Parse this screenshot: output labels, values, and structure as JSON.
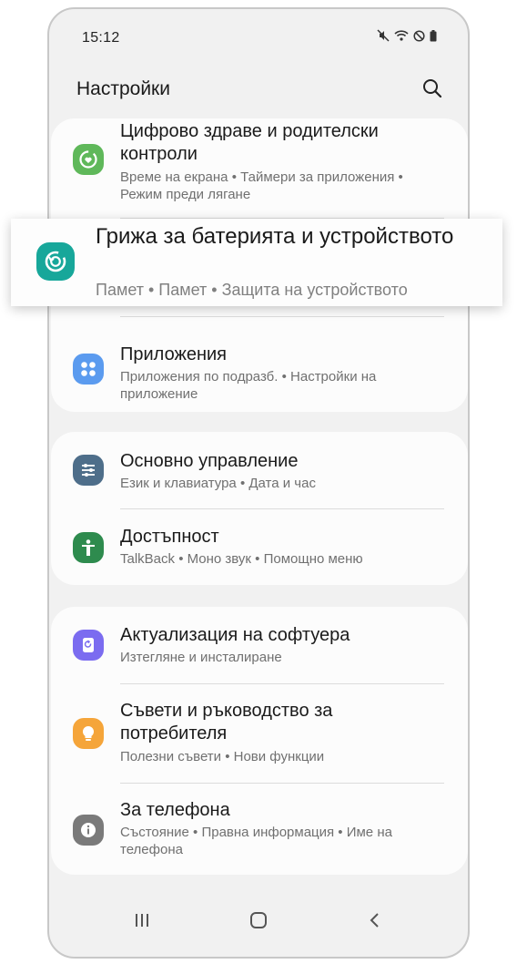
{
  "status_bar": {
    "time": "15:12",
    "icons": [
      "mute-icon",
      "wifi-icon",
      "do-not-disturb-icon",
      "battery-icon"
    ]
  },
  "header": {
    "title": "Настройки",
    "search_icon": "search-icon"
  },
  "highlighted_item": {
    "title": "Грижа за батерията и устройството",
    "subtitle": "Памет  •  Памет  •  Защита на устройството",
    "icon": "device-care-icon",
    "icon_color": "#17a79a"
  },
  "groups": [
    {
      "items": [
        {
          "title": "Цифрово здраве и родителски контроли",
          "subtitle": "Време на екрана  •  Таймери за приложения  •  Режим преди лягане",
          "icon": "digital-wellbeing-icon",
          "icon_color": "#5fb85a"
        },
        {
          "title": "Приложения",
          "subtitle": "Приложения по подразб.  •  Настройки на приложение",
          "icon": "apps-icon",
          "icon_color": "#5b9bef"
        }
      ]
    },
    {
      "items": [
        {
          "title": "Основно управление",
          "subtitle": "Език и клавиатура  •  Дата и час",
          "icon": "general-management-icon",
          "icon_color": "#4e6e8a"
        },
        {
          "title": "Достъпност",
          "subtitle": "TalkBack  •  Моно звук  •  Помощно меню",
          "icon": "accessibility-icon",
          "icon_color": "#2e8b4e"
        }
      ]
    },
    {
      "items": [
        {
          "title": "Актуализация на софтуера",
          "subtitle": "Изтегляне и инсталиране",
          "icon": "software-update-icon",
          "icon_color": "#7b6cf0"
        },
        {
          "title": "Съвети и ръководство за потребителя",
          "subtitle": "Полезни съвети  •  Нови функции",
          "icon": "tips-icon",
          "icon_color": "#f5a53a"
        },
        {
          "title": "За телефона",
          "subtitle": "Състояние  •  Правна информация  •  Име на телефона",
          "icon": "about-phone-icon",
          "icon_color": "#7a7a7a"
        }
      ]
    }
  ],
  "nav_bar": {
    "buttons": [
      "recents-icon",
      "home-icon",
      "back-icon"
    ]
  }
}
